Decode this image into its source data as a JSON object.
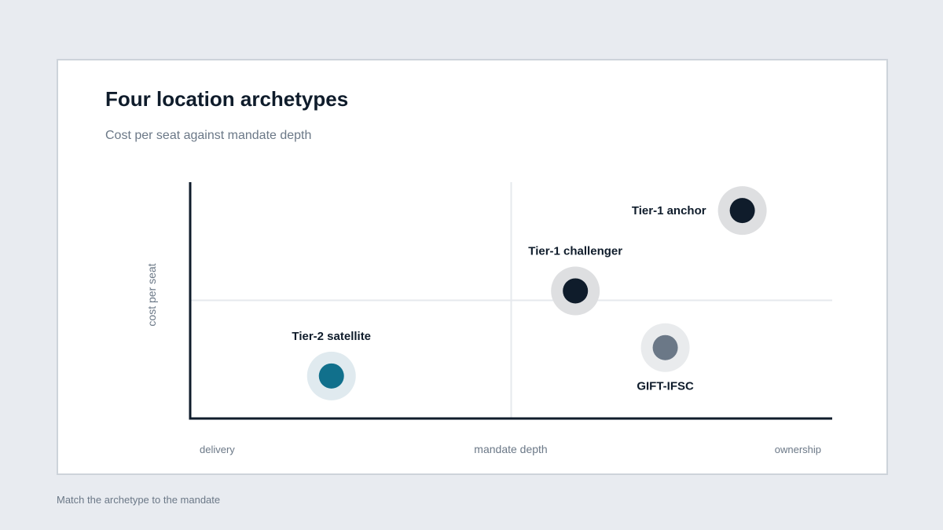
{
  "title": "Four location archetypes",
  "subtitle": "Cost per seat against mandate depth",
  "footer": "Match the archetype to the mandate",
  "colors": {
    "page_bg": "#e8ebf0",
    "card_bg": "#ffffff",
    "axis": "#0f1c2b",
    "divider": "#e6e9ed",
    "dark": "#0f1c2b",
    "teal": "#11708c",
    "slate": "#6b7887"
  },
  "chart_data": {
    "type": "scatter",
    "title": "",
    "xlabel": "mandate depth",
    "ylabel": "cost per seat",
    "x_low_label": "delivery",
    "x_high_label": "ownership",
    "xlim": [
      0,
      1
    ],
    "ylim": [
      0,
      1
    ],
    "grid": false,
    "quadrant_dividers": {
      "x": 0.5,
      "y": 0.5
    },
    "points": [
      {
        "label": "Tier-1 anchor",
        "x": 0.86,
        "y": 0.88,
        "color": "#0f1c2b",
        "halo": "#dedfe1",
        "label_position": "left"
      },
      {
        "label": "Tier-1 challenger",
        "x": 0.6,
        "y": 0.54,
        "color": "#0f1c2b",
        "halo": "#dedfe1",
        "label_position": "above"
      },
      {
        "label": "GIFT-IFSC",
        "x": 0.74,
        "y": 0.3,
        "color": "#6b7887",
        "halo": "#e9ebed",
        "label_position": "below"
      },
      {
        "label": "Tier-2 satellite",
        "x": 0.22,
        "y": 0.18,
        "color": "#11708c",
        "halo": "#e0eaef",
        "label_position": "above"
      }
    ]
  }
}
